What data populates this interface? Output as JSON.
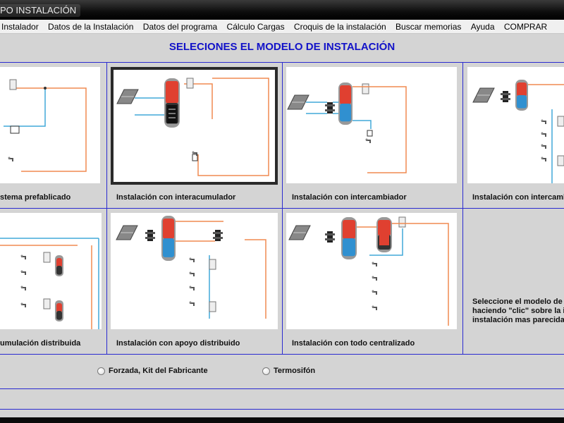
{
  "window": {
    "title": "PO INSTALACIÓN"
  },
  "menu": [
    "Instalador",
    "Datos de la Instalación",
    "Datos del programa",
    "Cálculo Cargas",
    "Croquis de la instalación",
    "Buscar memorias",
    "Ayuda",
    "COMPRAR"
  ],
  "heading": "SELECIONES EL MODELO DE INSTALACIÓN",
  "models": [
    {
      "caption": "stema prefablicado",
      "selected": false
    },
    {
      "caption": "Instalación con interacumulador",
      "selected": true
    },
    {
      "caption": "Instalación con intercambiador",
      "selected": false
    },
    {
      "caption": "Instalación con intercamb",
      "selected": false
    },
    {
      "caption": "umulación distribuida",
      "selected": false
    },
    {
      "caption": "Instalación con apoyo distribuido",
      "selected": false
    },
    {
      "caption": "Instalación con todo centralizado",
      "selected": false
    }
  ],
  "info": {
    "lines": [
      "Seleccione el modelo de in",
      "haciendo \"clic\" sobre la in",
      "instalación mas parecida"
    ]
  },
  "radios": [
    {
      "label": "Forzada, Kit del Fabricante",
      "checked": false
    },
    {
      "label": "Termosifón",
      "checked": false
    }
  ],
  "colors": {
    "heading": "#1212c8",
    "divider": "#2a2ad0",
    "panel": "#d4d4d4",
    "pipe_hot": "#f08a50",
    "pipe_cold": "#40a8d8",
    "tank_hot": "#e04030",
    "tank_cold": "#3090d0"
  }
}
